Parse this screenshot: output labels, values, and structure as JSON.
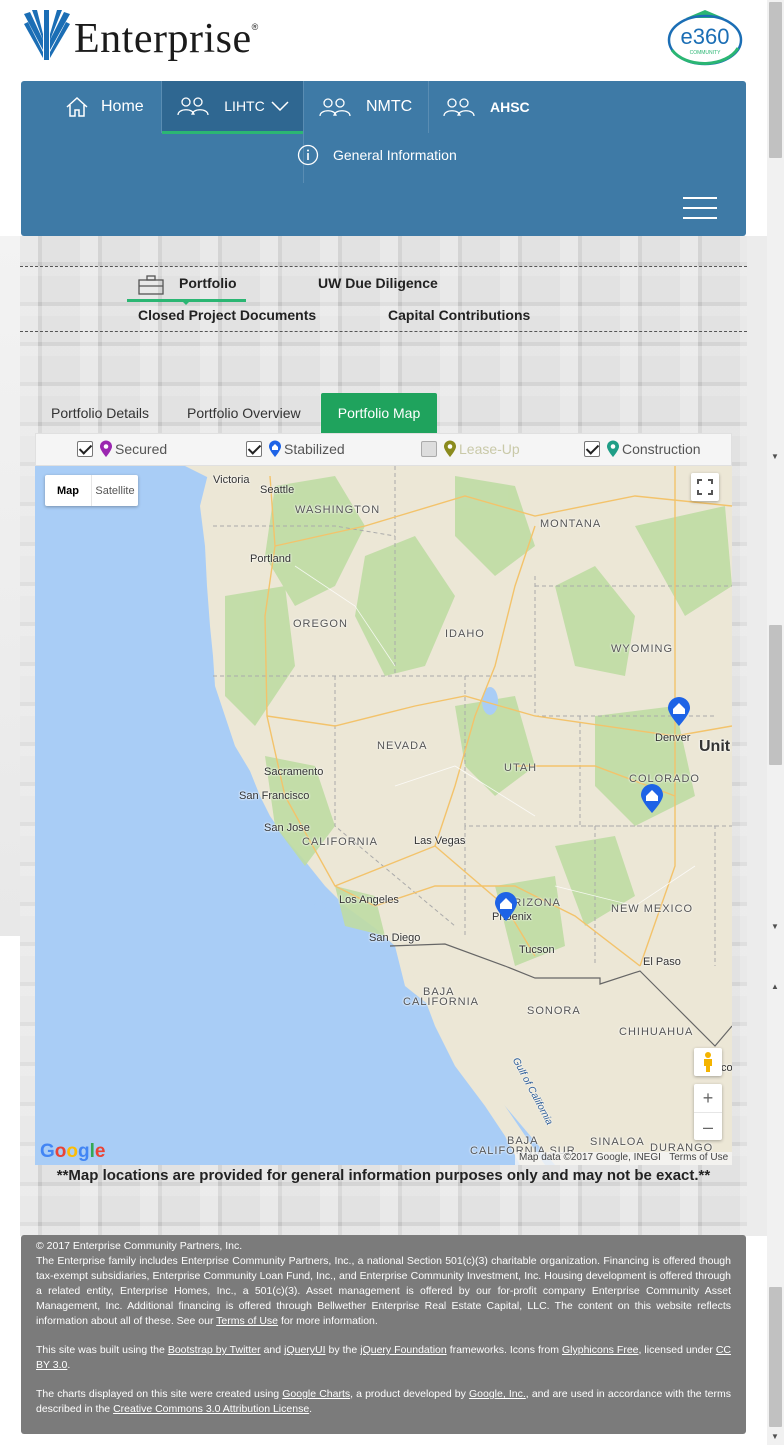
{
  "header": {
    "logo_text": "Enterprise",
    "badge_text_main": "e360",
    "badge_text_sub": "COMMUNITY"
  },
  "nav": {
    "items": [
      {
        "label": "Home",
        "icon": "home-icon"
      },
      {
        "label": "LIHTC",
        "icon": "people-icon",
        "active": true
      },
      {
        "label": "NMTC",
        "icon": "people-icon"
      },
      {
        "label": "AHSC",
        "icon": "people-icon"
      }
    ],
    "general_info": "General Information"
  },
  "subtabs": {
    "portfolio": "Portfolio",
    "uw": "UW Due Diligence",
    "closed": "Closed Project Documents",
    "capital": "Capital Contributions"
  },
  "portfolio_tabs": {
    "details": "Portfolio Details",
    "overview": "Portfolio Overview",
    "map": "Portfolio Map"
  },
  "legend": [
    {
      "label": "Secured",
      "checked": true,
      "color": "#9b27b0"
    },
    {
      "label": "Stabilized",
      "checked": true,
      "color": "#1e63e6"
    },
    {
      "label": "Lease-Up",
      "checked": false,
      "color": "#8b8b1e"
    },
    {
      "label": "Construction",
      "checked": true,
      "color": "#1f9e87"
    }
  ],
  "map": {
    "type_map": "Map",
    "type_satellite": "Satellite",
    "google": "Google",
    "attribution": "Map data ©2017 Google, INEGI",
    "terms": "Terms of Use",
    "labels": {
      "victoria": "Victoria",
      "seattle": "Seattle",
      "washington": "WASHINGTON",
      "montana": "MONTANA",
      "portland": "Portland",
      "oregon": "OREGON",
      "idaho": "IDAHO",
      "wyoming": "WYOMING",
      "nevada": "NEVADA",
      "utah": "UTAH",
      "denver": "Denver",
      "colorado": "COLORADO",
      "unit": "Unit",
      "sacramento": "Sacramento",
      "sanfrancisco": "San Francisco",
      "sanjose": "San Jose",
      "california": "CALIFORNIA",
      "lasvegas": "Las Vegas",
      "losangeles": "Los Angeles",
      "arizona": "ARIZONA",
      "phoenix": "Phoenix",
      "sandiego": "San Diego",
      "newmexico": "NEW MEXICO",
      "tucson": "Tucson",
      "elpaso": "El Paso",
      "baja": "BAJA",
      "bajacal": "CALIFORNIA",
      "sonora": "SONORA",
      "chihuahua": "CHIHUAHUA",
      "gulf": "Gulf of California",
      "bajasur1": "BAJA",
      "bajasur2": "CALIFORNIA SUR",
      "sinaloa": "SINALOA",
      "durango": "DURANGO",
      "co": "co"
    }
  },
  "disclaimer": "**Map locations are provided for general information purposes only and may not be exact.**",
  "footer": {
    "copyright": "© 2017 Enterprise Community Partners, Inc.",
    "p1_a": "The Enterprise family includes Enterprise Community Partners, Inc., a national Section 501(c)(3) charitable organization. Financing is offered though tax-exempt subsidiaries, Enterprise Community Loan Fund, Inc., and Enterprise Community Investment, Inc. Housing development is offered through a related entity, Enterprise Homes, Inc., a 501(c)(3). Asset management is offered by our for-profit company Enterprise Community Asset Management, Inc. Additional financing is offered through Bellwether Enterprise Real Estate Capital, LLC. The content on this website reflects information about all of these. See our ",
    "terms_link": "Terms of Use",
    "p1_b": " for more information.",
    "p2_a": "This site was built using the ",
    "bootstrap": "Bootstrap by Twitter",
    "p2_b": " and ",
    "jqueryui": "jQueryUI",
    "p2_c": " by the ",
    "jqueryfound": "jQuery Foundation",
    "p2_d": " frameworks. Icons from ",
    "glyphicons": "Glyphicons Free",
    "p2_e": ", licensed under ",
    "ccby": "CC BY 3.0",
    "p2_f": ".",
    "p3_a": "The charts displayed on this site were created using ",
    "gcharts": "Google Charts",
    "p3_b": ", a product developed by ",
    "googleinc": "Google, Inc.",
    "p3_c": ", and are used in accordance with the terms described in the ",
    "cclicense": "Creative Commons 3.0 Attribution License",
    "p3_d": "."
  }
}
